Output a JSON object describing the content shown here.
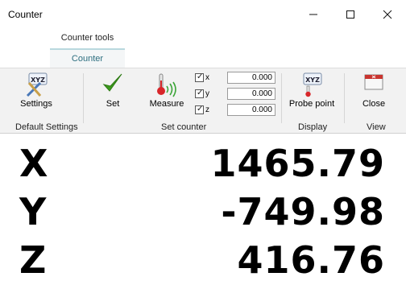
{
  "window": {
    "title": "Counter",
    "controls": {
      "minimize": "–",
      "maximize": "☐",
      "close": "✕"
    }
  },
  "ribbon": {
    "contextual_tab": "Counter tools",
    "active_tab": "Counter",
    "buttons": {
      "settings": "Settings",
      "set": "Set",
      "measure": "Measure",
      "probe_point": "Probe point",
      "close": "Close"
    },
    "xyz_badge": "XYZ",
    "axes_checks": [
      {
        "label": "x",
        "checked": true,
        "value": "0.000"
      },
      {
        "label": "y",
        "checked": true,
        "value": "0.000"
      },
      {
        "label": "z",
        "checked": true,
        "value": "0.000"
      }
    ],
    "groups": {
      "default_settings": "Default Settings",
      "set_counter": "Set counter",
      "display": "Display",
      "view": "View"
    }
  },
  "readout": [
    {
      "axis": "X",
      "value": "1465.79"
    },
    {
      "axis": "Y",
      "value": "-749.98"
    },
    {
      "axis": "Z",
      "value": "416.76"
    }
  ],
  "colors": {
    "accent_tab_text": "#2c6e7f",
    "checkmark_green": "#3c9a1e",
    "thermometer_red": "#d8262a",
    "signal_green": "#3aa436"
  }
}
